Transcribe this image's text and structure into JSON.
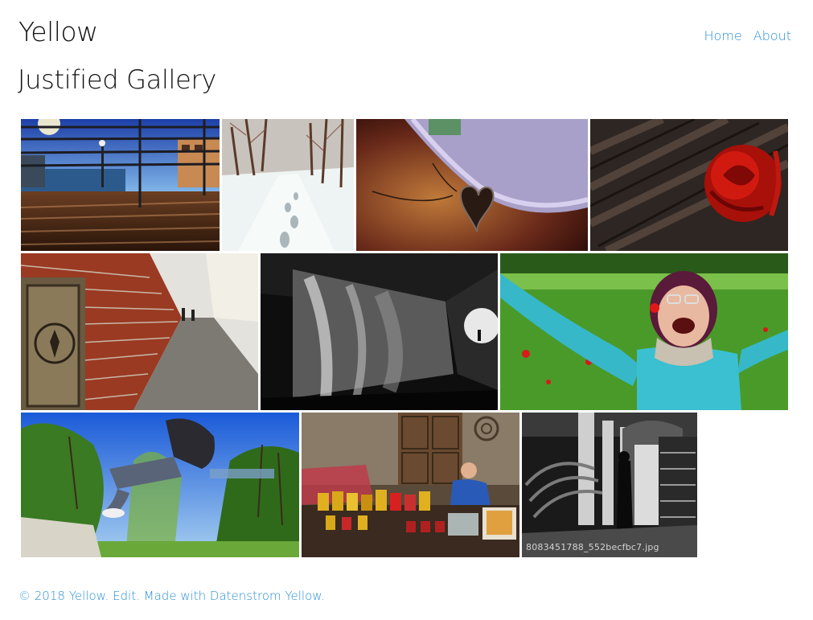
{
  "header": {
    "site_title": "Yellow",
    "nav": [
      {
        "label": "Home"
      },
      {
        "label": "About"
      }
    ]
  },
  "main": {
    "page_title": "Justified Gallery",
    "photos": [
      {
        "name": "photo-boardwalk-harbor"
      },
      {
        "name": "photo-snowy-path"
      },
      {
        "name": "photo-heart-necklace"
      },
      {
        "name": "photo-red-rose"
      },
      {
        "name": "photo-brick-wall"
      },
      {
        "name": "photo-tunnel-mural"
      },
      {
        "name": "photo-laughing-girl"
      },
      {
        "name": "photo-parkour-jump"
      },
      {
        "name": "photo-market-vendor"
      },
      {
        "name": "photo-library-hall",
        "caption": "8083451788_552becfbc7.jpg"
      }
    ]
  },
  "footer": {
    "copyright": "© 2018 Yellow.",
    "edit": "Edit.",
    "made_with": "Made with Datenstrom Yellow."
  },
  "colors": {
    "link": "#2a8fd6",
    "text": "#111111",
    "background": "#ffffff"
  }
}
